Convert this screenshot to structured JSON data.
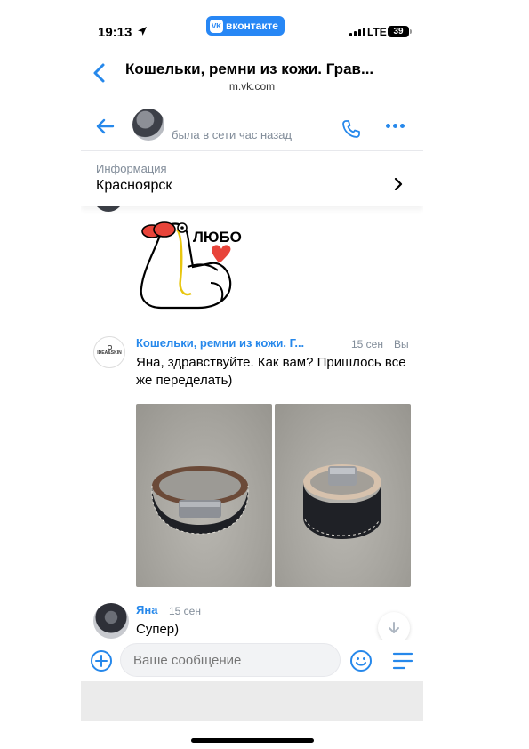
{
  "status": {
    "time": "19:13",
    "brand": "вконтакте",
    "brand_logo": "VK",
    "network": "LTE",
    "battery": "39"
  },
  "browser": {
    "title": "Кошельки, ремни из кожи. Грав...",
    "url": "m.vk.com"
  },
  "chat": {
    "presence": "была в сети час назад"
  },
  "info": {
    "label": "Информация",
    "value": "Красноярск"
  },
  "sticker": {
    "text": "ЛЮБО"
  },
  "messages": [
    {
      "sender": "Кошельки, ремни из кожи. Г...",
      "time": "15 сен",
      "extra": "Вы",
      "text": "Яна, здравствуйте. Как вам? Пришлось все же переделать)",
      "avatar_text": "IDEA&SKIN",
      "photos": [
        "photo-bracelet-1",
        "photo-bracelet-2"
      ]
    },
    {
      "sender": "Яна",
      "time": "15 сен",
      "text": "Супер)"
    }
  ],
  "composer": {
    "placeholder": "Ваше сообщение"
  },
  "colors": {
    "accent": "#2688eb",
    "secondary": "#818c99",
    "brand": "#2787f5",
    "heart": "#e8443a"
  }
}
